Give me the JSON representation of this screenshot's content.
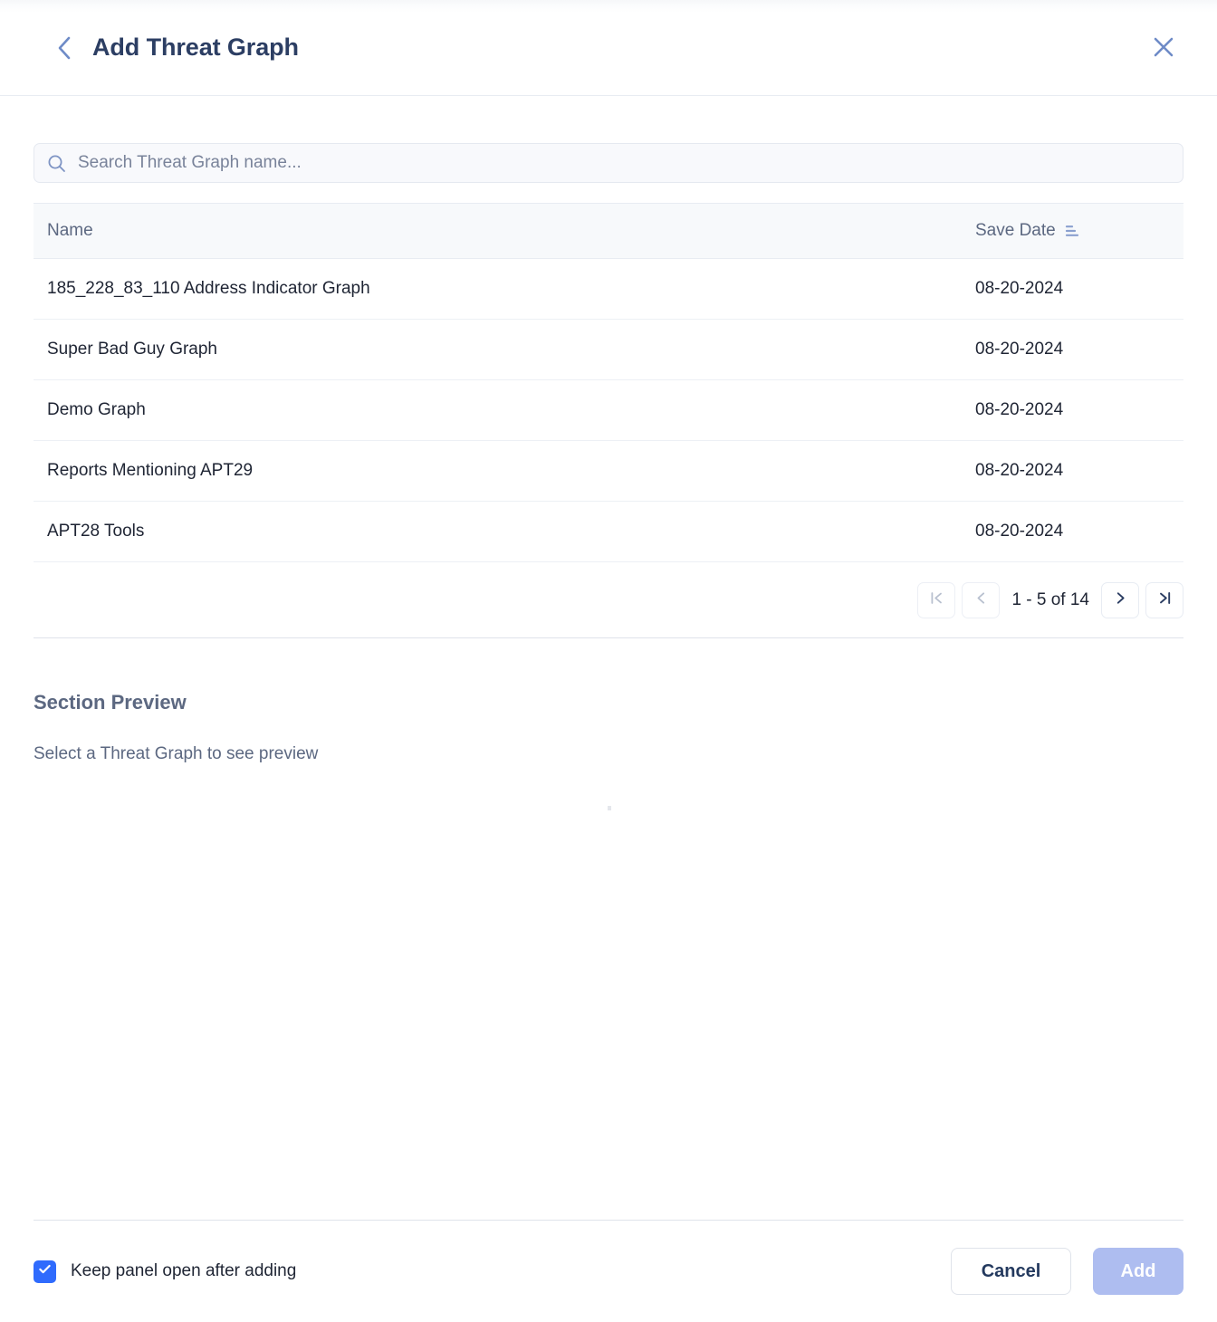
{
  "header": {
    "title": "Add Threat Graph",
    "back_icon": "chevron-left-icon",
    "close_icon": "close-icon"
  },
  "search": {
    "placeholder": "Search Threat Graph name...",
    "value": "",
    "icon": "search-icon"
  },
  "table": {
    "columns": [
      {
        "key": "name",
        "label": "Name"
      },
      {
        "key": "date",
        "label": "Save Date",
        "sort_icon": "sort-ascending-icon",
        "sorted": true
      }
    ],
    "rows": [
      {
        "name": "185_228_83_110 Address Indicator Graph",
        "date": "08-20-2024"
      },
      {
        "name": "Super Bad Guy Graph",
        "date": "08-20-2024"
      },
      {
        "name": "Demo Graph",
        "date": "08-20-2024"
      },
      {
        "name": "Reports Mentioning APT29",
        "date": "08-20-2024"
      },
      {
        "name": "APT28 Tools",
        "date": "08-20-2024"
      }
    ]
  },
  "pagination": {
    "range_label": "1 - 5 of 14",
    "first_icon": "first-page-icon",
    "prev_icon": "chevron-left-icon",
    "next_icon": "chevron-right-icon",
    "last_icon": "last-page-icon",
    "first_enabled": false,
    "prev_enabled": false,
    "next_enabled": true,
    "last_enabled": true
  },
  "preview": {
    "title": "Section Preview",
    "empty_text": "Select a Threat Graph to see preview"
  },
  "footer": {
    "keep_open_label": "Keep panel open after adding",
    "keep_open_checked": true,
    "cancel_label": "Cancel",
    "add_label": "Add",
    "add_enabled": false
  },
  "colors": {
    "title_navy": "#2c3e63",
    "accent_blue": "#2f6bfd",
    "icon_blue": "#6e8bc7",
    "muted_text": "#5c6881",
    "row_text": "#1f2534",
    "disabled_button": "#aebdf0",
    "border": "#e8ecf2",
    "header_bg": "#f7f9fb",
    "search_bg": "#f8f9fc"
  }
}
